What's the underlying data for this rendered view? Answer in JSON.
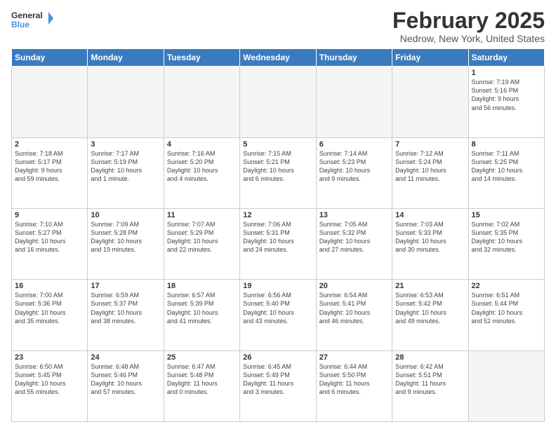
{
  "header": {
    "logo_general": "General",
    "logo_blue": "Blue",
    "title": "February 2025",
    "subtitle": "Nedrow, New York, United States"
  },
  "weekdays": [
    "Sunday",
    "Monday",
    "Tuesday",
    "Wednesday",
    "Thursday",
    "Friday",
    "Saturday"
  ],
  "weeks": [
    [
      {
        "day": "",
        "detail": "",
        "empty": true
      },
      {
        "day": "",
        "detail": "",
        "empty": true
      },
      {
        "day": "",
        "detail": "",
        "empty": true
      },
      {
        "day": "",
        "detail": "",
        "empty": true
      },
      {
        "day": "",
        "detail": "",
        "empty": true
      },
      {
        "day": "",
        "detail": "",
        "empty": true
      },
      {
        "day": "1",
        "detail": "Sunrise: 7:19 AM\nSunset: 5:16 PM\nDaylight: 9 hours\nand 56 minutes."
      }
    ],
    [
      {
        "day": "2",
        "detail": "Sunrise: 7:18 AM\nSunset: 5:17 PM\nDaylight: 9 hours\nand 59 minutes."
      },
      {
        "day": "3",
        "detail": "Sunrise: 7:17 AM\nSunset: 5:19 PM\nDaylight: 10 hours\nand 1 minute."
      },
      {
        "day": "4",
        "detail": "Sunrise: 7:16 AM\nSunset: 5:20 PM\nDaylight: 10 hours\nand 4 minutes."
      },
      {
        "day": "5",
        "detail": "Sunrise: 7:15 AM\nSunset: 5:21 PM\nDaylight: 10 hours\nand 6 minutes."
      },
      {
        "day": "6",
        "detail": "Sunrise: 7:14 AM\nSunset: 5:23 PM\nDaylight: 10 hours\nand 9 minutes."
      },
      {
        "day": "7",
        "detail": "Sunrise: 7:12 AM\nSunset: 5:24 PM\nDaylight: 10 hours\nand 11 minutes."
      },
      {
        "day": "8",
        "detail": "Sunrise: 7:11 AM\nSunset: 5:25 PM\nDaylight: 10 hours\nand 14 minutes."
      }
    ],
    [
      {
        "day": "9",
        "detail": "Sunrise: 7:10 AM\nSunset: 5:27 PM\nDaylight: 10 hours\nand 16 minutes."
      },
      {
        "day": "10",
        "detail": "Sunrise: 7:09 AM\nSunset: 5:28 PM\nDaylight: 10 hours\nand 19 minutes."
      },
      {
        "day": "11",
        "detail": "Sunrise: 7:07 AM\nSunset: 5:29 PM\nDaylight: 10 hours\nand 22 minutes."
      },
      {
        "day": "12",
        "detail": "Sunrise: 7:06 AM\nSunset: 5:31 PM\nDaylight: 10 hours\nand 24 minutes."
      },
      {
        "day": "13",
        "detail": "Sunrise: 7:05 AM\nSunset: 5:32 PM\nDaylight: 10 hours\nand 27 minutes."
      },
      {
        "day": "14",
        "detail": "Sunrise: 7:03 AM\nSunset: 5:33 PM\nDaylight: 10 hours\nand 30 minutes."
      },
      {
        "day": "15",
        "detail": "Sunrise: 7:02 AM\nSunset: 5:35 PM\nDaylight: 10 hours\nand 32 minutes."
      }
    ],
    [
      {
        "day": "16",
        "detail": "Sunrise: 7:00 AM\nSunset: 5:36 PM\nDaylight: 10 hours\nand 35 minutes."
      },
      {
        "day": "17",
        "detail": "Sunrise: 6:59 AM\nSunset: 5:37 PM\nDaylight: 10 hours\nand 38 minutes."
      },
      {
        "day": "18",
        "detail": "Sunrise: 6:57 AM\nSunset: 5:39 PM\nDaylight: 10 hours\nand 41 minutes."
      },
      {
        "day": "19",
        "detail": "Sunrise: 6:56 AM\nSunset: 5:40 PM\nDaylight: 10 hours\nand 43 minutes."
      },
      {
        "day": "20",
        "detail": "Sunrise: 6:54 AM\nSunset: 5:41 PM\nDaylight: 10 hours\nand 46 minutes."
      },
      {
        "day": "21",
        "detail": "Sunrise: 6:53 AM\nSunset: 5:42 PM\nDaylight: 10 hours\nand 49 minutes."
      },
      {
        "day": "22",
        "detail": "Sunrise: 6:51 AM\nSunset: 5:44 PM\nDaylight: 10 hours\nand 52 minutes."
      }
    ],
    [
      {
        "day": "23",
        "detail": "Sunrise: 6:50 AM\nSunset: 5:45 PM\nDaylight: 10 hours\nand 55 minutes."
      },
      {
        "day": "24",
        "detail": "Sunrise: 6:48 AM\nSunset: 5:46 PM\nDaylight: 10 hours\nand 57 minutes."
      },
      {
        "day": "25",
        "detail": "Sunrise: 6:47 AM\nSunset: 5:48 PM\nDaylight: 11 hours\nand 0 minutes."
      },
      {
        "day": "26",
        "detail": "Sunrise: 6:45 AM\nSunset: 5:49 PM\nDaylight: 11 hours\nand 3 minutes."
      },
      {
        "day": "27",
        "detail": "Sunrise: 6:44 AM\nSunset: 5:50 PM\nDaylight: 11 hours\nand 6 minutes."
      },
      {
        "day": "28",
        "detail": "Sunrise: 6:42 AM\nSunset: 5:51 PM\nDaylight: 11 hours\nand 9 minutes."
      },
      {
        "day": "",
        "detail": "",
        "empty": true
      }
    ]
  ]
}
